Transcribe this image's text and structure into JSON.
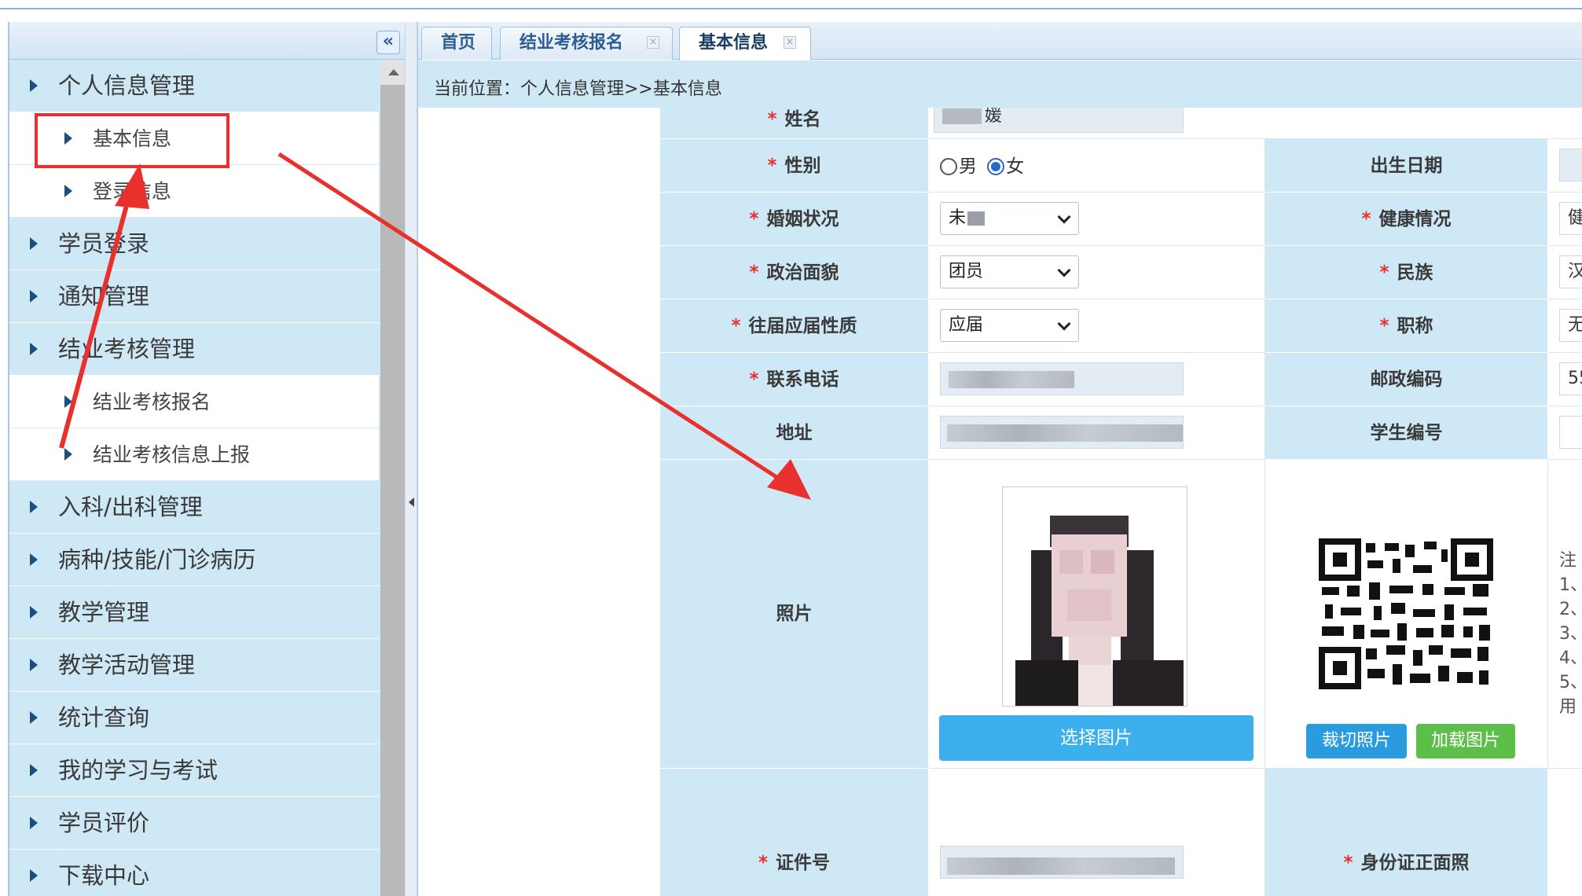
{
  "sidebar": {
    "collapse_glyph": "«",
    "items": [
      {
        "label": "个人信息管理",
        "sub": false
      },
      {
        "label": "基本信息",
        "sub": true
      },
      {
        "label": "登录信息",
        "sub": true
      },
      {
        "label": "学员登录",
        "sub": false
      },
      {
        "label": "通知管理",
        "sub": false
      },
      {
        "label": "结业考核管理",
        "sub": false
      },
      {
        "label": "结业考核报名",
        "sub": true
      },
      {
        "label": "结业考核信息上报",
        "sub": true
      },
      {
        "label": "入科/出科管理",
        "sub": false
      },
      {
        "label": "病种/技能/门诊病历",
        "sub": false
      },
      {
        "label": "教学管理",
        "sub": false
      },
      {
        "label": "教学活动管理",
        "sub": false
      },
      {
        "label": "统计查询",
        "sub": false
      },
      {
        "label": "我的学习与考试",
        "sub": false
      },
      {
        "label": "学员评价",
        "sub": false
      },
      {
        "label": "下载中心",
        "sub": false
      }
    ]
  },
  "tabs": [
    {
      "label": "首页"
    },
    {
      "label": "结业考核报名"
    },
    {
      "label": "基本信息"
    }
  ],
  "tab_close_glyph": "×",
  "breadcrumb": "当前位置：个人信息管理>>基本信息",
  "form": {
    "req_mark": "*",
    "name": {
      "label": "姓名",
      "value": "媛"
    },
    "gender": {
      "label": "性别",
      "male": "男",
      "female": "女",
      "selected": "女"
    },
    "birth": {
      "label": "出生日期"
    },
    "marriage": {
      "label": "婚姻状况",
      "value": "未"
    },
    "health": {
      "label": "健康情况",
      "value": "健"
    },
    "politics": {
      "label": "政治面貌",
      "value": "团员"
    },
    "nation": {
      "label": "民族",
      "value": "汉"
    },
    "graduate": {
      "label": "往届应届性质",
      "value": "应届"
    },
    "title": {
      "label": "职称",
      "value": "无"
    },
    "phone": {
      "label": "联系电话"
    },
    "postcode": {
      "label": "邮政编码",
      "value": "55"
    },
    "address": {
      "label": "地址"
    },
    "student_no": {
      "label": "学生编号"
    },
    "photo": {
      "label": "照片",
      "select_button": "选择图片"
    },
    "crop_button": "裁切照片",
    "load_button": "加载图片",
    "notes": [
      "注",
      "1、",
      "2、",
      "3、",
      "4、",
      "5、",
      "用"
    ],
    "idno": {
      "label": "证件号"
    },
    "id_front": {
      "label": "身份证正面照"
    }
  },
  "colors": {
    "sidebar_bg": "#cfe8f5",
    "accent_red": "#e8302c",
    "select_btn": "#3cb0ec",
    "load_btn": "#5ebe4a"
  }
}
